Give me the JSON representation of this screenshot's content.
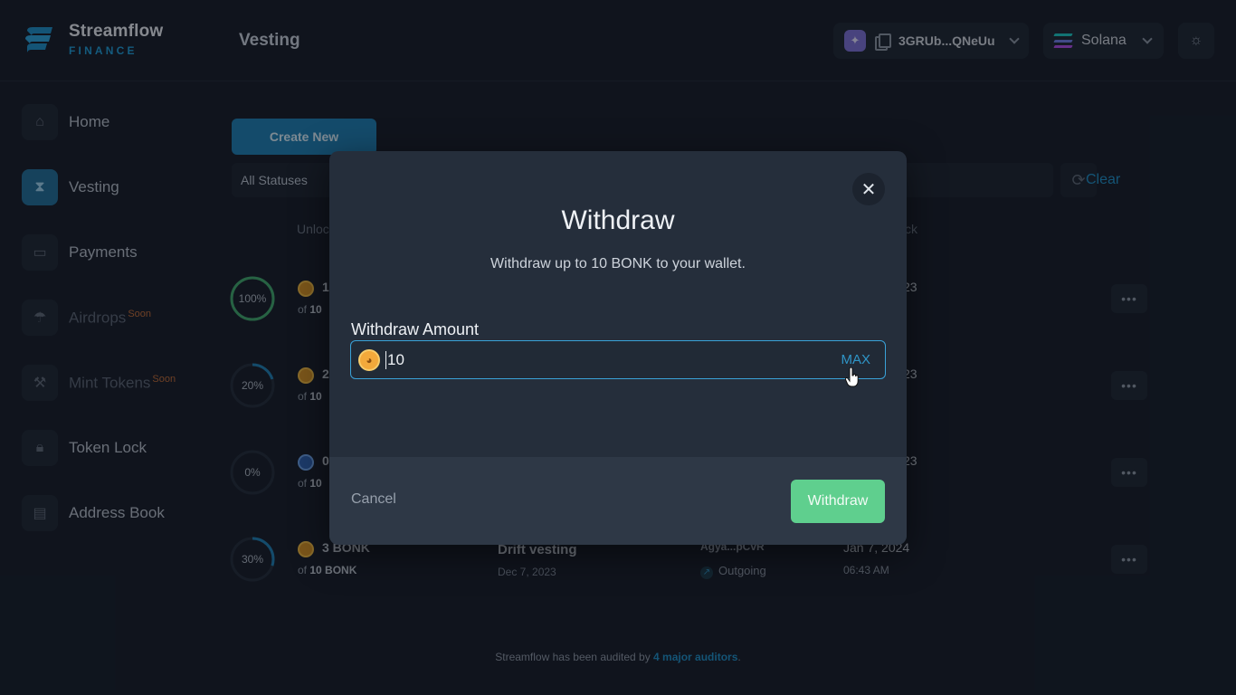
{
  "header": {
    "brand_name": "Streamflow",
    "brand_sub": "FINANCE",
    "page_title": "Vesting",
    "wallet_address": "3GRUb...QNeUu",
    "network": "Solana"
  },
  "sidebar": {
    "items": [
      {
        "label": "Home",
        "icon": "home-icon"
      },
      {
        "label": "Vesting",
        "icon": "hourglass-icon"
      },
      {
        "label": "Payments",
        "icon": "money-icon"
      },
      {
        "label": "Airdrops",
        "icon": "parachute-icon",
        "badge": "Soon"
      },
      {
        "label": "Mint Tokens",
        "icon": "hammer-icon",
        "badge": "Soon"
      },
      {
        "label": "Token Lock",
        "icon": "lock-icon"
      },
      {
        "label": "Address Book",
        "icon": "contact-book-icon"
      }
    ]
  },
  "toolbar": {
    "create_label": "Create New",
    "status_filter": "All Statuses",
    "clear_label": "Clear"
  },
  "table": {
    "col_unlock_partial": "Unloc",
    "col_lock_partial": "ck",
    "rows": [
      {
        "progress": "100%",
        "progress_value": 1.0,
        "amount": "1",
        "of_label": "of",
        "total": "10",
        "end_date": "23"
      },
      {
        "progress": "20%",
        "progress_value": 0.2,
        "amount": "2",
        "of_label": "of",
        "total": "10",
        "end_date": "23"
      },
      {
        "progress": "0%",
        "progress_value": 0.0,
        "amount": "0",
        "of_label": "of",
        "total": "10",
        "end_date": "23"
      },
      {
        "progress": "30%",
        "progress_value": 0.3,
        "amount": "3 BONK",
        "of_label": "of",
        "total": "10 BONK",
        "name": "Drift vesting",
        "created": "Dec 7, 2023",
        "recipient": "Agya...pCvR",
        "direction": "Outgoing",
        "end_date": "Jan 7, 2024",
        "end_time": "06:43 AM"
      }
    ]
  },
  "footer": {
    "text": "Streamflow has been audited by ",
    "link": "4 major auditors",
    "suffix": "."
  },
  "modal": {
    "title": "Withdraw",
    "subtitle": "Withdraw up to 10 BONK to your wallet.",
    "amount_label": "Withdraw Amount",
    "amount_value": "10",
    "max_label": "MAX",
    "cancel_label": "Cancel",
    "withdraw_label": "Withdraw"
  },
  "colors": {
    "accent": "#1d8fc6",
    "success": "#5fcf8e",
    "background": "#141b26",
    "modal": "#252e3b"
  }
}
